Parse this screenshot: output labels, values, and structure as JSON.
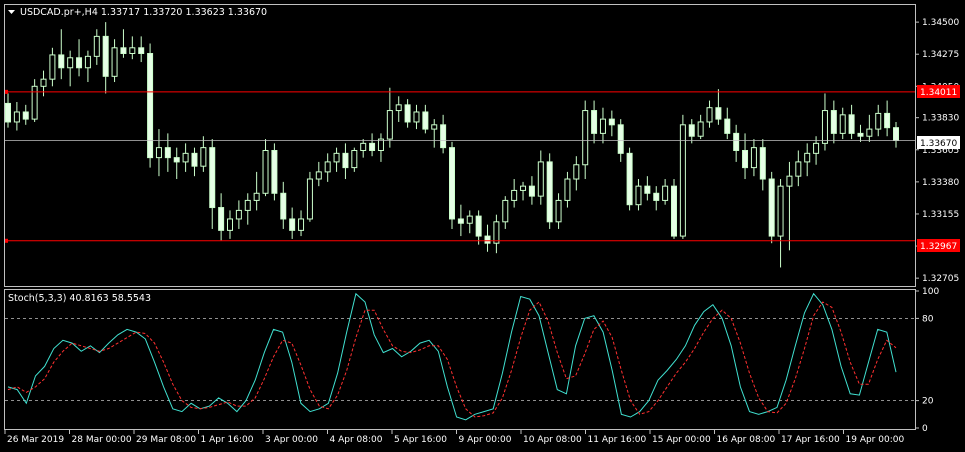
{
  "main_panel": {
    "title": "USDCAD.pr+,H4  1.33717 1.33720 1.33623 1.33670",
    "price_axis_labels": [
      "1.34500",
      "1.34275",
      "1.34050",
      "1.33830",
      "1.33605",
      "1.33380",
      "1.33155",
      "1.32930",
      "1.32705"
    ],
    "current_price_label": "1.33670",
    "resistance_label": "1.34011",
    "support_label": "1.32967"
  },
  "stoch_panel": {
    "title": "Stoch(5,3,3) 40.8163 58.5543",
    "level_labels": [
      "100",
      "80",
      "20",
      "0"
    ]
  },
  "time_axis_labels": [
    "26 Mar 2019",
    "28 Mar 00:00",
    "29 Mar 08:00",
    "1 Apr 16:00",
    "3 Apr 00:00",
    "4 Apr 08:00",
    "5 Apr 16:00",
    "9 Apr 00:00",
    "10 Apr 08:00",
    "11 Apr 16:00",
    "15 Apr 00:00",
    "16 Apr 08:00",
    "17 Apr 16:00",
    "19 Apr 00:00"
  ],
  "colors": {
    "background": "#000000",
    "grid_frame": "#c0c0c0",
    "bull_candle": "#ffffff",
    "bear_candle": "#e6ffe6",
    "wick": "#ccffcc",
    "red_line": "#ff0000",
    "stoch_main": "#40e0d0",
    "stoch_signal": "#ff3030",
    "text": "#ffffff"
  },
  "chart_data": {
    "type": "candlestick",
    "symbol": "USDCAD.pr+",
    "timeframe": "H4",
    "ylim": [
      1.3265,
      1.3462
    ],
    "horizontal_lines": [
      1.34011,
      1.32967
    ],
    "current_price": 1.3367,
    "candles": [
      [
        1.3393,
        1.34,
        1.3376,
        1.338
      ],
      [
        1.338,
        1.3394,
        1.3374,
        1.3387
      ],
      [
        1.3387,
        1.3392,
        1.3378,
        1.3382
      ],
      [
        1.3382,
        1.341,
        1.338,
        1.3405
      ],
      [
        1.3405,
        1.3416,
        1.3398,
        1.341
      ],
      [
        1.341,
        1.3432,
        1.3405,
        1.3427
      ],
      [
        1.3427,
        1.3445,
        1.341,
        1.3418
      ],
      [
        1.3418,
        1.343,
        1.3405,
        1.3425
      ],
      [
        1.3425,
        1.3438,
        1.3412,
        1.3418
      ],
      [
        1.3418,
        1.343,
        1.3408,
        1.3426
      ],
      [
        1.3426,
        1.3445,
        1.342,
        1.344
      ],
      [
        1.344,
        1.345,
        1.34,
        1.3412
      ],
      [
        1.3412,
        1.3438,
        1.3408,
        1.3432
      ],
      [
        1.3432,
        1.3445,
        1.3425,
        1.3428
      ],
      [
        1.3428,
        1.344,
        1.3424,
        1.3432
      ],
      [
        1.3432,
        1.344,
        1.3422,
        1.3428
      ],
      [
        1.3428,
        1.3435,
        1.3348,
        1.3355
      ],
      [
        1.3355,
        1.3375,
        1.3342,
        1.3362
      ],
      [
        1.3362,
        1.3372,
        1.3345,
        1.3355
      ],
      [
        1.3355,
        1.3362,
        1.334,
        1.3352
      ],
      [
        1.3352,
        1.3365,
        1.3345,
        1.3358
      ],
      [
        1.3358,
        1.3362,
        1.3342,
        1.3349
      ],
      [
        1.3349,
        1.337,
        1.3345,
        1.3362
      ],
      [
        1.3362,
        1.3368,
        1.3305,
        1.332
      ],
      [
        1.332,
        1.333,
        1.3297,
        1.3304
      ],
      [
        1.3304,
        1.3318,
        1.3298,
        1.3312
      ],
      [
        1.3312,
        1.3325,
        1.3305,
        1.3318
      ],
      [
        1.3318,
        1.333,
        1.3308,
        1.3325
      ],
      [
        1.3325,
        1.3345,
        1.3318,
        1.333
      ],
      [
        1.333,
        1.3368,
        1.3328,
        1.336
      ],
      [
        1.336,
        1.3365,
        1.3325,
        1.333
      ],
      [
        1.333,
        1.3338,
        1.3305,
        1.3312
      ],
      [
        1.3312,
        1.332,
        1.3298,
        1.3304
      ],
      [
        1.3304,
        1.3318,
        1.33,
        1.3312
      ],
      [
        1.3312,
        1.3345,
        1.331,
        1.334
      ],
      [
        1.334,
        1.3352,
        1.3335,
        1.3345
      ],
      [
        1.3345,
        1.3358,
        1.3338,
        1.3352
      ],
      [
        1.3352,
        1.3362,
        1.3345,
        1.3358
      ],
      [
        1.3358,
        1.3365,
        1.334,
        1.3348
      ],
      [
        1.3348,
        1.3362,
        1.3345,
        1.336
      ],
      [
        1.336,
        1.3368,
        1.3355,
        1.3365
      ],
      [
        1.3365,
        1.3372,
        1.3356,
        1.336
      ],
      [
        1.336,
        1.3372,
        1.3352,
        1.3368
      ],
      [
        1.3368,
        1.3404,
        1.3362,
        1.3388
      ],
      [
        1.3388,
        1.3398,
        1.338,
        1.3392
      ],
      [
        1.3392,
        1.3396,
        1.3376,
        1.338
      ],
      [
        1.338,
        1.3392,
        1.3375,
        1.3387
      ],
      [
        1.3387,
        1.3392,
        1.3372,
        1.3375
      ],
      [
        1.3375,
        1.3382,
        1.3362,
        1.3378
      ],
      [
        1.3378,
        1.3385,
        1.3358,
        1.3362
      ],
      [
        1.3362,
        1.3366,
        1.3305,
        1.3312
      ],
      [
        1.3312,
        1.3322,
        1.33,
        1.3309
      ],
      [
        1.3309,
        1.3318,
        1.3302,
        1.3314
      ],
      [
        1.3314,
        1.3318,
        1.3294,
        1.33
      ],
      [
        1.33,
        1.3308,
        1.3289,
        1.3295
      ],
      [
        1.3295,
        1.3315,
        1.3288,
        1.331
      ],
      [
        1.331,
        1.3328,
        1.3305,
        1.3325
      ],
      [
        1.3325,
        1.334,
        1.332,
        1.3332
      ],
      [
        1.3332,
        1.3338,
        1.3325,
        1.3335
      ],
      [
        1.3335,
        1.3342,
        1.3322,
        1.3328
      ],
      [
        1.3328,
        1.336,
        1.3322,
        1.3352
      ],
      [
        1.3352,
        1.3358,
        1.3305,
        1.331
      ],
      [
        1.331,
        1.333,
        1.3305,
        1.3325
      ],
      [
        1.3325,
        1.3345,
        1.332,
        1.334
      ],
      [
        1.334,
        1.3356,
        1.3332,
        1.335
      ],
      [
        1.335,
        1.3395,
        1.334,
        1.3388
      ],
      [
        1.3388,
        1.3395,
        1.3365,
        1.3372
      ],
      [
        1.3372,
        1.339,
        1.3365,
        1.3382
      ],
      [
        1.3382,
        1.3388,
        1.337,
        1.3378
      ],
      [
        1.3378,
        1.3382,
        1.3352,
        1.3358
      ],
      [
        1.3358,
        1.3362,
        1.3318,
        1.3322
      ],
      [
        1.3322,
        1.334,
        1.3318,
        1.3335
      ],
      [
        1.3335,
        1.3342,
        1.3325,
        1.333
      ],
      [
        1.333,
        1.3335,
        1.3318,
        1.3325
      ],
      [
        1.3325,
        1.334,
        1.3322,
        1.3335
      ],
      [
        1.3335,
        1.334,
        1.3298,
        1.33
      ],
      [
        1.33,
        1.3385,
        1.3298,
        1.3378
      ],
      [
        1.3378,
        1.3382,
        1.3365,
        1.337
      ],
      [
        1.337,
        1.3385,
        1.3368,
        1.338
      ],
      [
        1.338,
        1.3395,
        1.3376,
        1.339
      ],
      [
        1.339,
        1.3403,
        1.3378,
        1.3382
      ],
      [
        1.3382,
        1.339,
        1.3368,
        1.3372
      ],
      [
        1.3372,
        1.3378,
        1.3352,
        1.336
      ],
      [
        1.336,
        1.3372,
        1.334,
        1.3348
      ],
      [
        1.3348,
        1.3368,
        1.3342,
        1.3362
      ],
      [
        1.3362,
        1.3368,
        1.3332,
        1.334
      ],
      [
        1.334,
        1.3345,
        1.3295,
        1.33
      ],
      [
        1.33,
        1.334,
        1.3278,
        1.3335
      ],
      [
        1.3335,
        1.3352,
        1.329,
        1.3342
      ],
      [
        1.3342,
        1.336,
        1.3335,
        1.3352
      ],
      [
        1.3352,
        1.3365,
        1.3342,
        1.3358
      ],
      [
        1.3358,
        1.337,
        1.335,
        1.3365
      ],
      [
        1.3365,
        1.34,
        1.336,
        1.3388
      ],
      [
        1.3388,
        1.3395,
        1.3365,
        1.3372
      ],
      [
        1.3372,
        1.339,
        1.3368,
        1.3385
      ],
      [
        1.3385,
        1.3392,
        1.3368,
        1.3372
      ],
      [
        1.3372,
        1.3378,
        1.3366,
        1.337
      ],
      [
        1.337,
        1.3385,
        1.3366,
        1.3375
      ],
      [
        1.3375,
        1.3392,
        1.337,
        1.3386
      ],
      [
        1.3386,
        1.3395,
        1.337,
        1.3376
      ],
      [
        1.3376,
        1.338,
        1.3362,
        1.3367
      ]
    ],
    "stochastic": {
      "name": "Stoch(5,3,3)",
      "main_last": 40.8163,
      "signal_last": 58.5543,
      "levels": [
        80,
        20
      ],
      "ylim": [
        0,
        100
      ],
      "main": [
        30,
        28,
        18,
        38,
        45,
        58,
        64,
        62,
        56,
        60,
        55,
        62,
        68,
        72,
        70,
        65,
        48,
        30,
        14,
        12,
        18,
        14,
        16,
        22,
        18,
        12,
        20,
        35,
        55,
        72,
        70,
        48,
        18,
        12,
        14,
        18,
        40,
        70,
        98,
        92,
        68,
        55,
        58,
        52,
        56,
        62,
        64,
        56,
        30,
        8,
        6,
        10,
        12,
        14,
        40,
        70,
        96,
        94,
        82,
        55,
        28,
        25,
        60,
        80,
        82,
        70,
        42,
        10,
        8,
        12,
        20,
        35,
        42,
        50,
        60,
        75,
        85,
        90,
        80,
        60,
        30,
        12,
        10,
        12,
        15,
        35,
        60,
        84,
        98,
        90,
        72,
        45,
        25,
        24,
        48,
        72,
        70,
        40.8163
      ],
      "signal": [
        28,
        30,
        26,
        30,
        36,
        48,
        56,
        62,
        60,
        58,
        56,
        58,
        62,
        66,
        70,
        69,
        62,
        48,
        32,
        20,
        15,
        14,
        15,
        17,
        19,
        16,
        16,
        22,
        36,
        52,
        64,
        62,
        46,
        28,
        16,
        14,
        24,
        42,
        66,
        86,
        86,
        72,
        60,
        56,
        55,
        57,
        60,
        60,
        50,
        30,
        14,
        8,
        9,
        11,
        22,
        42,
        66,
        86,
        92,
        78,
        55,
        36,
        38,
        54,
        72,
        78,
        66,
        42,
        20,
        10,
        12,
        20,
        30,
        40,
        48,
        58,
        70,
        80,
        86,
        80,
        62,
        40,
        22,
        12,
        11,
        18,
        36,
        58,
        82,
        92,
        88,
        70,
        48,
        32,
        32,
        50,
        64,
        58.5543
      ]
    }
  }
}
